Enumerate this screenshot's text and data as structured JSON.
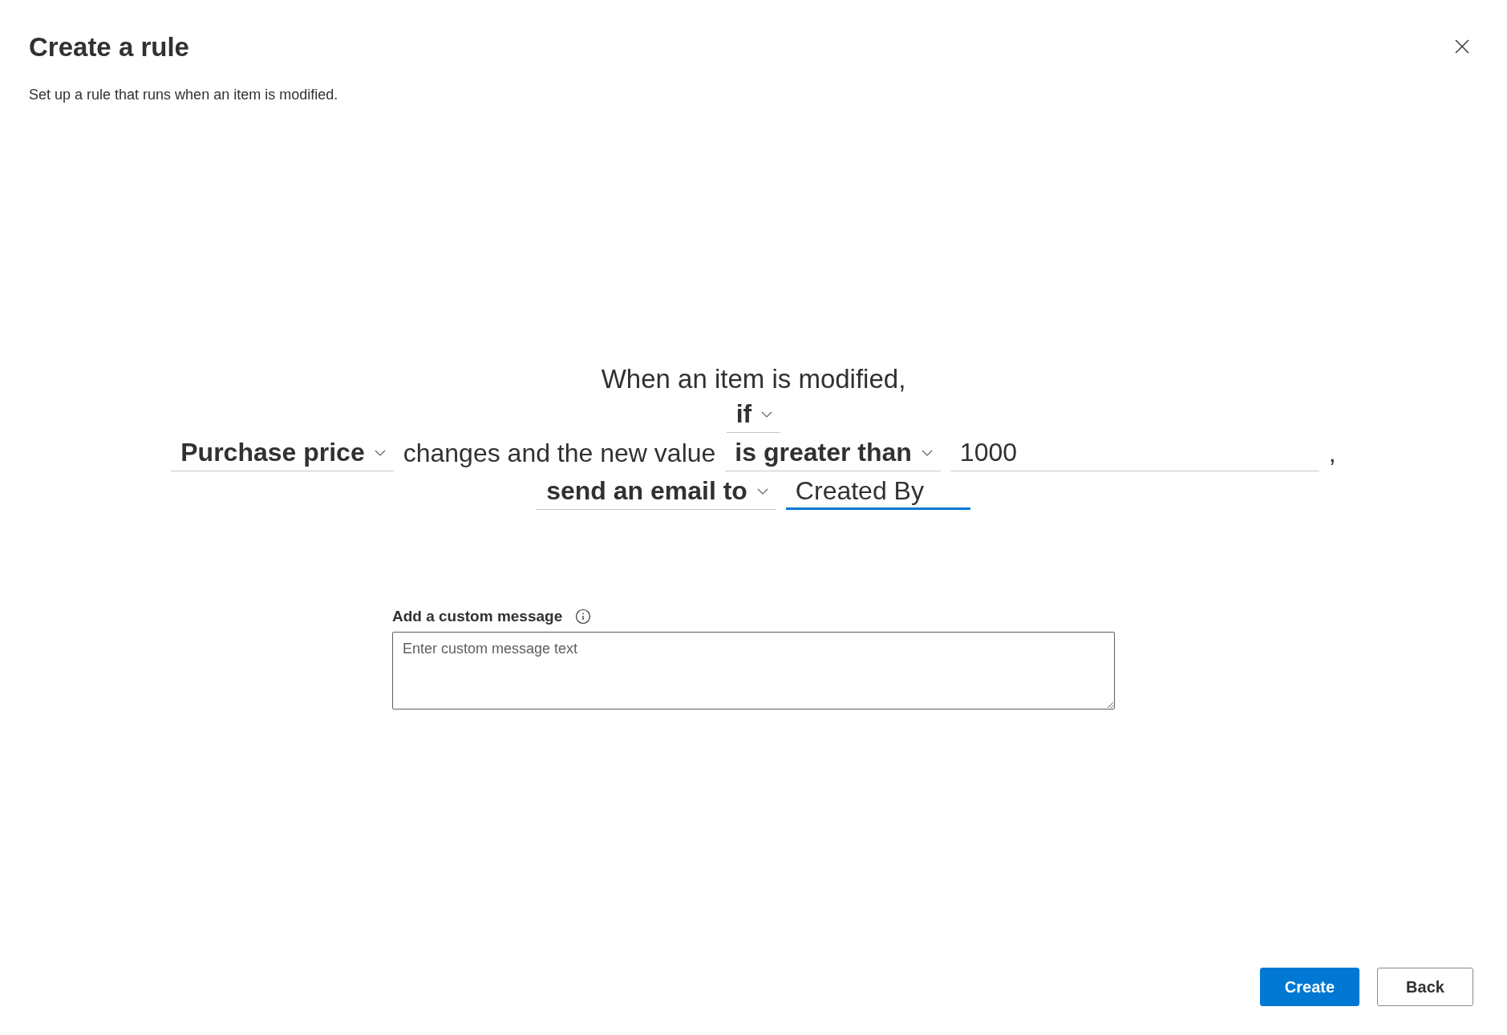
{
  "dialog": {
    "title": "Create a rule",
    "subtitle": "Set up a rule that runs when an item is modified."
  },
  "rule": {
    "intro": "When an item is modified,",
    "lines": [
      [
        {
          "kind": "dropdown",
          "value": "if"
        }
      ],
      [
        {
          "kind": "dropdown",
          "value": "Purchase price"
        },
        {
          "kind": "text",
          "value": "changes and the new value"
        },
        {
          "kind": "dropdown",
          "value": "is greater than"
        },
        {
          "kind": "input",
          "value": "1000",
          "focused": false
        },
        {
          "kind": "text",
          "value": ","
        }
      ],
      [
        {
          "kind": "dropdown",
          "value": "send an email to"
        },
        {
          "kind": "input",
          "value": "Created By",
          "focused": true
        }
      ]
    ]
  },
  "custom_message": {
    "label": "Add a custom message",
    "placeholder": "Enter custom message text"
  },
  "buttons": [
    {
      "label": "Create",
      "primary": true
    },
    {
      "label": "Back",
      "primary": false
    }
  ]
}
